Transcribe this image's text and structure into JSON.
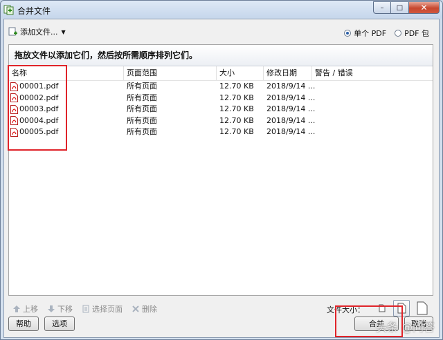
{
  "window": {
    "title": "合并文件",
    "controls": {
      "minimize": "–",
      "maximize": "□",
      "close": "✕"
    }
  },
  "toolbar": {
    "add_files_label": "添加文件...",
    "output_options": [
      {
        "label": "单个 PDF",
        "selected": true
      },
      {
        "label": "PDF 包",
        "selected": false
      }
    ]
  },
  "panel": {
    "instruction": "拖放文件以添加它们，然后按所需顺序排列它们。",
    "columns": [
      "名称",
      "页面范围",
      "大小",
      "修改日期",
      "警告 / 错误"
    ],
    "rows": [
      {
        "name": "00001.pdf",
        "range": "所有页面",
        "size": "12.70 KB",
        "date": "2018/9/14 ...",
        "warning": ""
      },
      {
        "name": "00002.pdf",
        "range": "所有页面",
        "size": "12.70 KB",
        "date": "2018/9/14 ...",
        "warning": ""
      },
      {
        "name": "00003.pdf",
        "range": "所有页面",
        "size": "12.70 KB",
        "date": "2018/9/14 ...",
        "warning": ""
      },
      {
        "name": "00004.pdf",
        "range": "所有页面",
        "size": "12.70 KB",
        "date": "2018/9/14 ...",
        "warning": ""
      },
      {
        "name": "00005.pdf",
        "range": "所有页面",
        "size": "12.70 KB",
        "date": "2018/9/14 ...",
        "warning": ""
      }
    ]
  },
  "actions": {
    "move_up": "上移",
    "move_down": "下移",
    "select_pages": "选择页面",
    "delete": "删除",
    "file_size_label": "文件大小："
  },
  "bottom": {
    "help": "帮助",
    "options": "选项",
    "merge": "合并",
    "cancel": "取消",
    "watermark": "头条 @问答"
  },
  "colors": {
    "highlight": "#e0242a",
    "title_bar": "#c7d7ec",
    "close_button": "#c7472f"
  }
}
